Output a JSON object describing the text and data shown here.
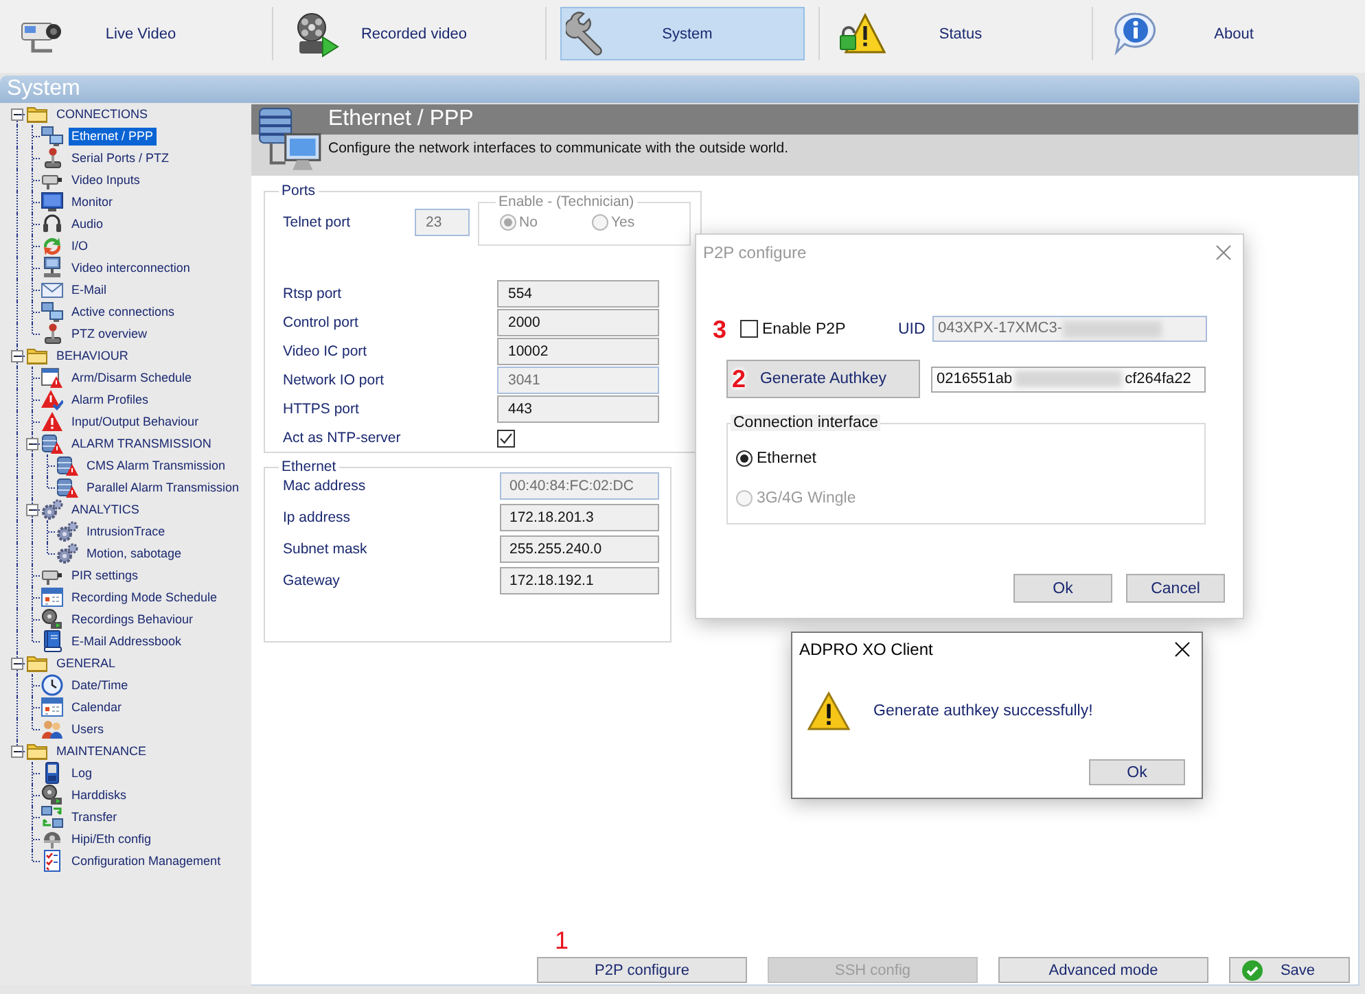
{
  "toolbar": {
    "tabs": [
      {
        "label": "Live Video",
        "selected": false
      },
      {
        "label": "Recorded video",
        "selected": false
      },
      {
        "label": "System",
        "selected": true
      },
      {
        "label": "Status",
        "selected": false
      },
      {
        "label": "About",
        "selected": false
      }
    ]
  },
  "section_bar": {
    "title": "System"
  },
  "sidebar": {
    "groups": [
      {
        "label": "CONNECTIONS",
        "selected": false,
        "expanded": true,
        "children": [
          {
            "label": "Ethernet / PPP",
            "selected": true
          },
          {
            "label": "Serial Ports / PTZ",
            "selected": false
          },
          {
            "label": "Video Inputs",
            "selected": false
          },
          {
            "label": "Monitor",
            "selected": false
          },
          {
            "label": "Audio",
            "selected": false
          },
          {
            "label": "I/O",
            "selected": false
          },
          {
            "label": "Video interconnection",
            "selected": false
          },
          {
            "label": "E-Mail",
            "selected": false
          },
          {
            "label": "Active connections",
            "selected": false
          },
          {
            "label": "PTZ overview",
            "selected": false
          }
        ]
      },
      {
        "label": "BEHAVIOUR",
        "selected": false,
        "expanded": true,
        "children": [
          {
            "label": "Arm/Disarm Schedule",
            "selected": false
          },
          {
            "label": "Alarm Profiles",
            "selected": false
          },
          {
            "label": "Input/Output Behaviour",
            "selected": false
          },
          {
            "label": "ALARM TRANSMISSION",
            "selected": false,
            "expanded": true,
            "children": [
              {
                "label": "CMS Alarm Transmission",
                "selected": false
              },
              {
                "label": "Parallel Alarm Transmission",
                "selected": false
              }
            ]
          },
          {
            "label": "ANALYTICS",
            "selected": false,
            "expanded": true,
            "children": [
              {
                "label": "IntrusionTrace",
                "selected": false
              },
              {
                "label": "Motion, sabotage",
                "selected": false
              }
            ]
          },
          {
            "label": "PIR settings",
            "selected": false
          },
          {
            "label": "Recording Mode Schedule",
            "selected": false
          },
          {
            "label": "Recordings Behaviour",
            "selected": false
          },
          {
            "label": "E-Mail Addressbook",
            "selected": false
          }
        ]
      },
      {
        "label": "GENERAL",
        "selected": false,
        "expanded": true,
        "children": [
          {
            "label": "Date/Time",
            "selected": false
          },
          {
            "label": "Calendar",
            "selected": false
          },
          {
            "label": "Users",
            "selected": false
          }
        ]
      },
      {
        "label": "MAINTENANCE",
        "selected": false,
        "expanded": true,
        "children": [
          {
            "label": "Log",
            "selected": false
          },
          {
            "label": "Harddisks",
            "selected": false
          },
          {
            "label": "Transfer",
            "selected": false
          },
          {
            "label": "Hipi/Eth config",
            "selected": false
          },
          {
            "label": "Configuration Management",
            "selected": false
          }
        ]
      }
    ]
  },
  "page_header": {
    "title": "Ethernet / PPP",
    "description": "Configure the network interfaces to communicate with the outside world."
  },
  "ports": {
    "legend": "Ports",
    "telnet": {
      "label": "Telnet port",
      "value": "23",
      "disabled": true
    },
    "enable": {
      "legend": "Enable - (Technician)",
      "disabled": true,
      "options": [
        {
          "label": "No",
          "selected": true
        },
        {
          "label": "Yes",
          "selected": false
        }
      ]
    },
    "fields": [
      {
        "label": "Rtsp port",
        "value": "554",
        "disabled": false
      },
      {
        "label": "Control port",
        "value": "2000",
        "disabled": false
      },
      {
        "label": "Video IC port",
        "value": "10002",
        "disabled": false
      },
      {
        "label": "Network IO port",
        "value": "3041",
        "disabled": true
      },
      {
        "label": "HTTPS port",
        "value": "443",
        "disabled": false
      }
    ],
    "ntp": {
      "label": "Act as NTP-server",
      "checked": true
    }
  },
  "ethernet": {
    "legend": "Ethernet",
    "fields": [
      {
        "label": "Mac address",
        "value": "00:40:84:FC:02:DC",
        "disabled": true
      },
      {
        "label": "Ip address",
        "value": "172.18.201.3",
        "disabled": false
      },
      {
        "label": "Subnet mask",
        "value": "255.255.240.0",
        "disabled": false
      },
      {
        "label": "Gateway",
        "value": "172.18.192.1",
        "disabled": false
      }
    ]
  },
  "buttons": [
    {
      "label": "P2P configure",
      "kind": "plain",
      "disabled": false,
      "annotation": "1"
    },
    {
      "label": "SSH config",
      "kind": "plain",
      "disabled": true
    },
    {
      "label": "Advanced mode",
      "kind": "plain",
      "disabled": false
    },
    {
      "label": "Save",
      "kind": "save",
      "disabled": false
    }
  ],
  "p2p_dialog": {
    "title": "P2P configure",
    "focused": false,
    "enable": {
      "label": "Enable P2P",
      "checked": false,
      "annotation": "3"
    },
    "uid": {
      "label": "UID",
      "value": "043XPX-17XMC3-",
      "disabled": true,
      "redacted": true
    },
    "generate_button": {
      "label": "Generate Authkey",
      "annotation": "2"
    },
    "authkey": {
      "value_start": "0216551ab",
      "value_end": "cf264fa22",
      "redacted": true
    },
    "interface": {
      "legend": "Connection interface",
      "options": [
        {
          "label": "Ethernet",
          "selected": true,
          "disabled": false
        },
        {
          "label": "3G/4G Wingle",
          "selected": false,
          "disabled": true
        }
      ]
    },
    "buttons": [
      {
        "label": "Ok"
      },
      {
        "label": "Cancel"
      }
    ]
  },
  "alert_dialog": {
    "title": "ADPRO XO Client",
    "focused": true,
    "message": "Generate authkey successfully!",
    "button": "Ok"
  }
}
